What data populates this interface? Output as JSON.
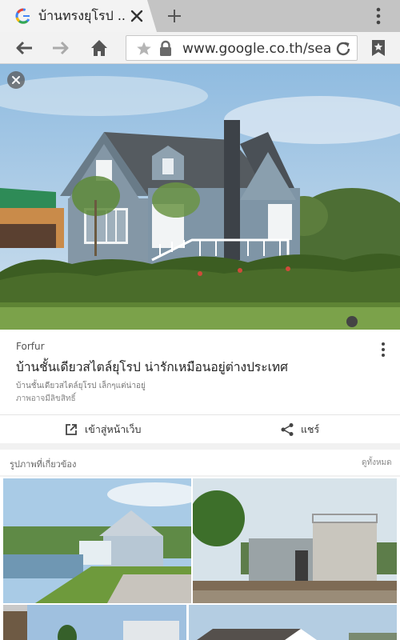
{
  "browser": {
    "tab_title": "บ้านทรงยุโรป ...",
    "url": "www.google.co.th/search"
  },
  "card": {
    "source": "Forfur",
    "title": "บ้านชั้นเดียวสไตล์ยุโรป น่ารักเหมือนอยู่ต่างประเทศ",
    "subtitle": "บ้านชั้นเดียวสไตล์ยุโรป เล็กๆแต่น่าอยู่",
    "license": "ภาพอาจมีลิขสิทธิ์",
    "visit_label": "เข้าสู่หน้าเว็บ",
    "share_label": "แชร์"
  },
  "related": {
    "label": "รูปภาพที่เกี่ยวข้อง",
    "view_all": "ดูทั้งหมด"
  },
  "colors": {
    "accent_google_blue": "#4285f4",
    "sky": "#a9cbe6",
    "house_siding": "#7f95a6"
  },
  "icons": {
    "tab_favicon": "google-g-icon",
    "tab_close": "close-icon",
    "new_tab": "plus-icon",
    "menu": "three-dots-vertical-icon",
    "back": "arrow-left-icon",
    "forward": "arrow-right-icon",
    "home": "home-icon",
    "bookmark": "star-icon",
    "secure": "lock-icon",
    "reload": "reload-icon",
    "bookmarks": "bookmarks-icon",
    "visit": "open-in-new-icon",
    "share": "share-icon"
  }
}
